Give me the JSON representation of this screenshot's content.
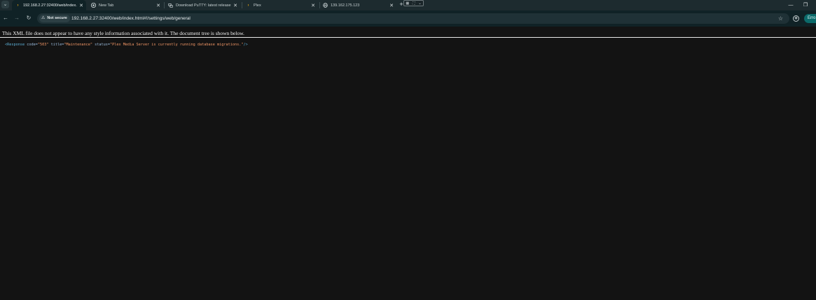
{
  "tabs": [
    {
      "title": "192.168.2.27:32400/web/index.",
      "icon": "plex-chevron-icon",
      "active": true
    },
    {
      "title": "New Tab",
      "icon": "chrome-icon",
      "active": false
    },
    {
      "title": "Download PuTTY: latest release",
      "icon": "putty-icon",
      "active": false
    },
    {
      "title": "Plex",
      "icon": "plex-chevron-icon",
      "active": false
    },
    {
      "title": "139.162.175.123",
      "icon": "globe-icon",
      "active": false
    }
  ],
  "toolbar": {
    "security_chip": "Not secure",
    "url": "192.168.2.27:32400/web/index.html#!/settings/web/general",
    "profile_pill": "Erro"
  },
  "page": {
    "notice": "This XML file does not appear to have any style information associated with it. The document tree is shown below.",
    "xml": {
      "tag_open": "<Response",
      "attr_code": "code=",
      "val_code": "\"503\"",
      "attr_title": "title=",
      "val_title": "\"Maintenance\"",
      "attr_status": "status=",
      "val_status": "\"Plex Media Server is currently running database migrations.\"",
      "tag_close": "/>"
    }
  },
  "colors": {
    "tabstrip": "#1d2b2f",
    "toolbar": "#102226",
    "page_bg": "#131313",
    "plex_orange": "#e5a00d",
    "xml_tag": "#5db0d7",
    "xml_value": "#f29766"
  }
}
